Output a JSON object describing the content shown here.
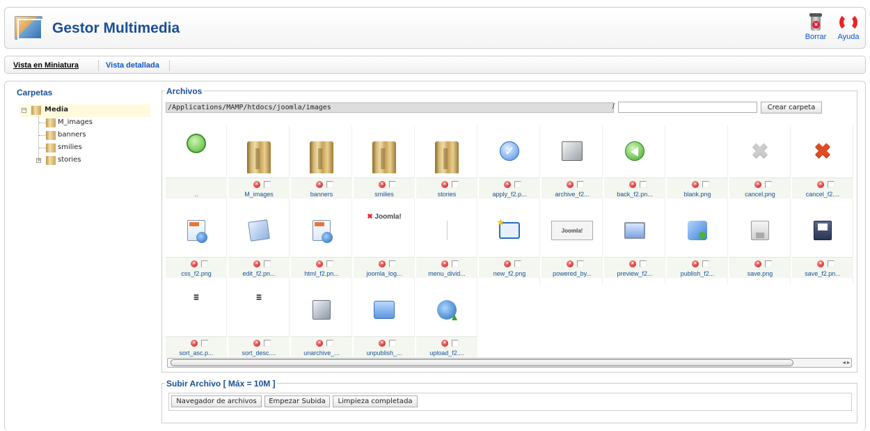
{
  "header": {
    "title": "Gestor Multimedia",
    "delete_label": "Borrar",
    "help_label": "Ayuda"
  },
  "tabs": [
    {
      "label": "Vista en Miniatura",
      "active": true
    },
    {
      "label": "Vista detallada",
      "active": false
    }
  ],
  "sidebar": {
    "title": "Carpetas",
    "root": "Media",
    "items": [
      "M_images",
      "banners",
      "smilies",
      "stories"
    ]
  },
  "files": {
    "legend": "Archivos",
    "path": "/Applications/MAMP/htdocs/joomla/images",
    "path_sep": "/",
    "new_folder_value": "",
    "create_folder_label": "Crear carpeta",
    "up_label": "..",
    "items": [
      {
        "name": "M_images",
        "icon": "folder-icon"
      },
      {
        "name": "banners",
        "icon": "folder-icon"
      },
      {
        "name": "smilies",
        "icon": "folder-icon"
      },
      {
        "name": "stories",
        "icon": "folder-icon"
      },
      {
        "name": "apply_f2.p...",
        "icon": "apply-icon"
      },
      {
        "name": "archive_f2...",
        "icon": "archive-icon"
      },
      {
        "name": "back_f2.pn...",
        "icon": "back-icon"
      },
      {
        "name": "blank.png",
        "icon": "blank-icon"
      },
      {
        "name": "cancel.png",
        "icon": "cancel-gray-icon"
      },
      {
        "name": "cancel_f2....",
        "icon": "cancel-red-icon"
      },
      {
        "name": "css_f2.png",
        "icon": "css-icon"
      },
      {
        "name": "edit_f2.pn...",
        "icon": "edit-icon"
      },
      {
        "name": "html_f2.pn...",
        "icon": "html-icon"
      },
      {
        "name": "joomla_log...",
        "icon": "joomla-logo-icon"
      },
      {
        "name": "menu_divid...",
        "icon": "menu-divider-icon"
      },
      {
        "name": "new_f2.png",
        "icon": "new-icon"
      },
      {
        "name": "powered_by...",
        "icon": "powered-by-icon"
      },
      {
        "name": "preview_f2...",
        "icon": "preview-icon"
      },
      {
        "name": "publish_f2...",
        "icon": "publish-icon"
      },
      {
        "name": "save.png",
        "icon": "save-icon"
      },
      {
        "name": "save_f2.pn...",
        "icon": "save-f2-icon"
      },
      {
        "name": "sort_asc.p...",
        "icon": "sort-asc-icon"
      },
      {
        "name": "sort_desc....",
        "icon": "sort-desc-icon"
      },
      {
        "name": "unarchive_...",
        "icon": "unarchive-icon"
      },
      {
        "name": "unpublish_...",
        "icon": "unpublish-icon"
      },
      {
        "name": "upload_f2....",
        "icon": "upload-icon"
      }
    ],
    "logo_text_j": "✖",
    "logo_text": "Joomla!",
    "powered_text": "Joomla!"
  },
  "upload": {
    "legend": "Subir Archivo [ Máx = 10M ]",
    "browse_label": "Navegador de archivos",
    "start_label": "Empezar Subida",
    "clear_label": "Limpieza completada"
  },
  "colors": {
    "accent": "#1a4e97",
    "link": "#0b55c4"
  }
}
